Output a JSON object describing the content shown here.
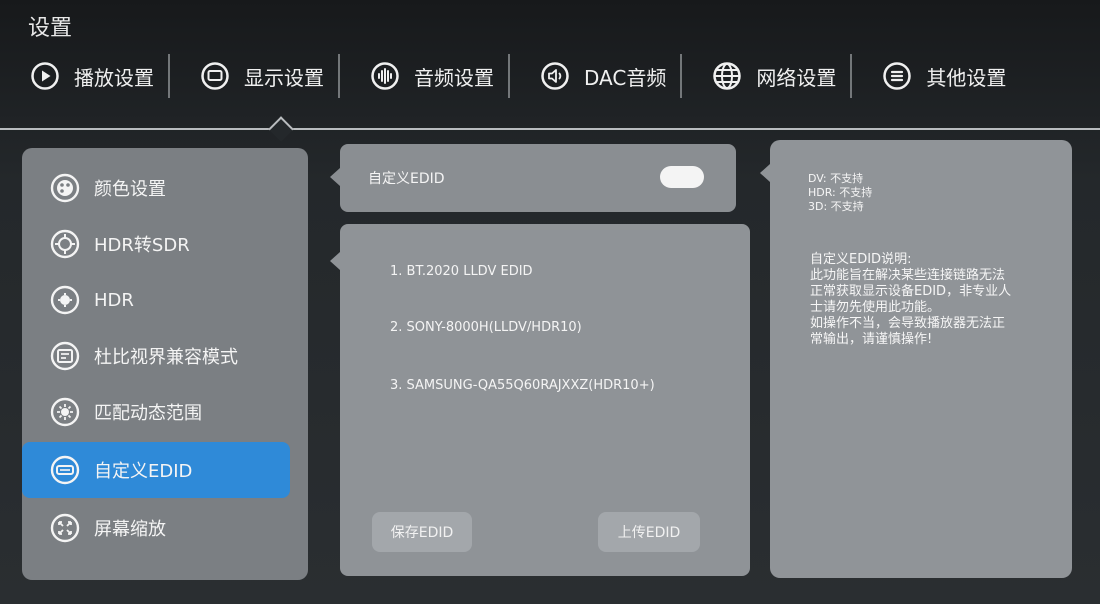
{
  "page": {
    "title": "设置"
  },
  "top_tabs": [
    {
      "label": "播放设置",
      "icon": "play-icon"
    },
    {
      "label": "显示设置",
      "icon": "display-icon",
      "selected": true
    },
    {
      "label": "音频设置",
      "icon": "audio-wave-icon"
    },
    {
      "label": "DAC音频",
      "icon": "speaker-icon"
    },
    {
      "label": "网络设置",
      "icon": "globe-icon"
    },
    {
      "label": "其他设置",
      "icon": "menu-list-icon"
    }
  ],
  "left_menu": [
    {
      "label": "颜色设置",
      "icon": "palette-icon"
    },
    {
      "label": "HDR转SDR",
      "icon": "hdr-convert-icon"
    },
    {
      "label": "HDR",
      "icon": "hdr-icon"
    },
    {
      "label": "杜比视界兼容模式",
      "icon": "dolby-vision-icon"
    },
    {
      "label": "匹配动态范围",
      "icon": "dynamic-range-icon"
    },
    {
      "label": "自定义EDID",
      "icon": "edid-icon",
      "selected": true
    },
    {
      "label": "屏幕缩放",
      "icon": "screen-zoom-icon"
    }
  ],
  "edid_toggle": {
    "label": "自定义EDID",
    "state": "on"
  },
  "edid_options": [
    "1. BT.2020 LLDV EDID",
    "2. SONY-8000H(LLDV/HDR10)",
    "3. SAMSUNG-QA55Q60RAJXXZ(HDR10+)"
  ],
  "buttons": {
    "save": "保存EDID",
    "upload": "上传EDID"
  },
  "info": {
    "dv": "DV: 不支持",
    "hdr": "HDR: 不支持",
    "3d": "3D: 不支持",
    "desc_lines": [
      "自定义EDID说明:",
      "此功能旨在解决某些连接链路无法",
      "正常获取显示设备EDID，非专业人",
      "士请勿先使用此功能。",
      "如操作不当，会导致播放器无法正",
      "常输出，请谨慎操作!"
    ]
  },
  "colors": {
    "accent_blue": "#2f8ad8",
    "panel_gray": "#7b7f83",
    "background": "#24282b"
  }
}
